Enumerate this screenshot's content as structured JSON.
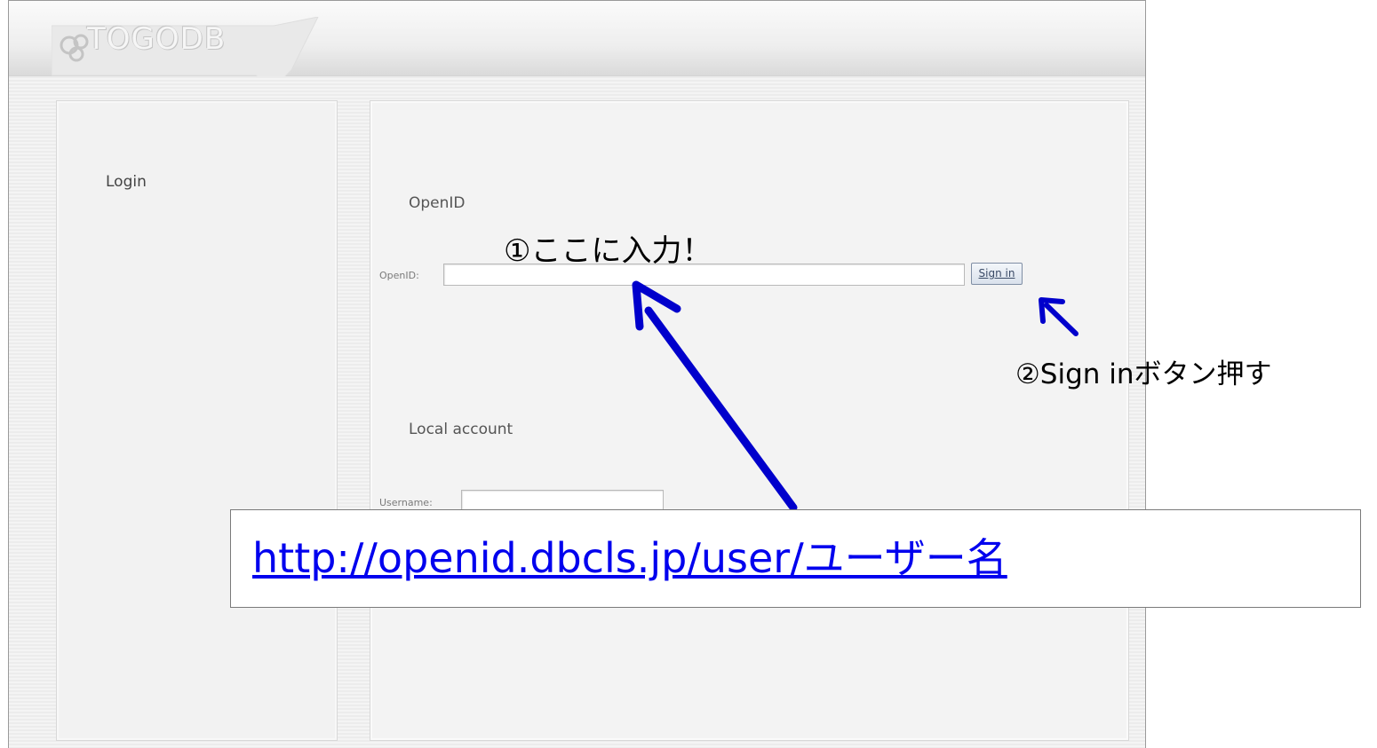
{
  "app": {
    "logo_text": "TOGODB"
  },
  "sidebar": {
    "login_label": "Login"
  },
  "openid_section": {
    "title": "OpenID",
    "field_label": "OpenID:",
    "field_value": "",
    "sign_in_label": "Sign in"
  },
  "local_section": {
    "title": "Local account",
    "username_label": "Username:",
    "username_value": ""
  },
  "annotations": {
    "step1": "①ここに入力！",
    "step2": "②Sign inボタン押す",
    "url_example": "http://openid.dbcls.jp/user/ユーザー名",
    "arrow_color": "#0000cc"
  }
}
